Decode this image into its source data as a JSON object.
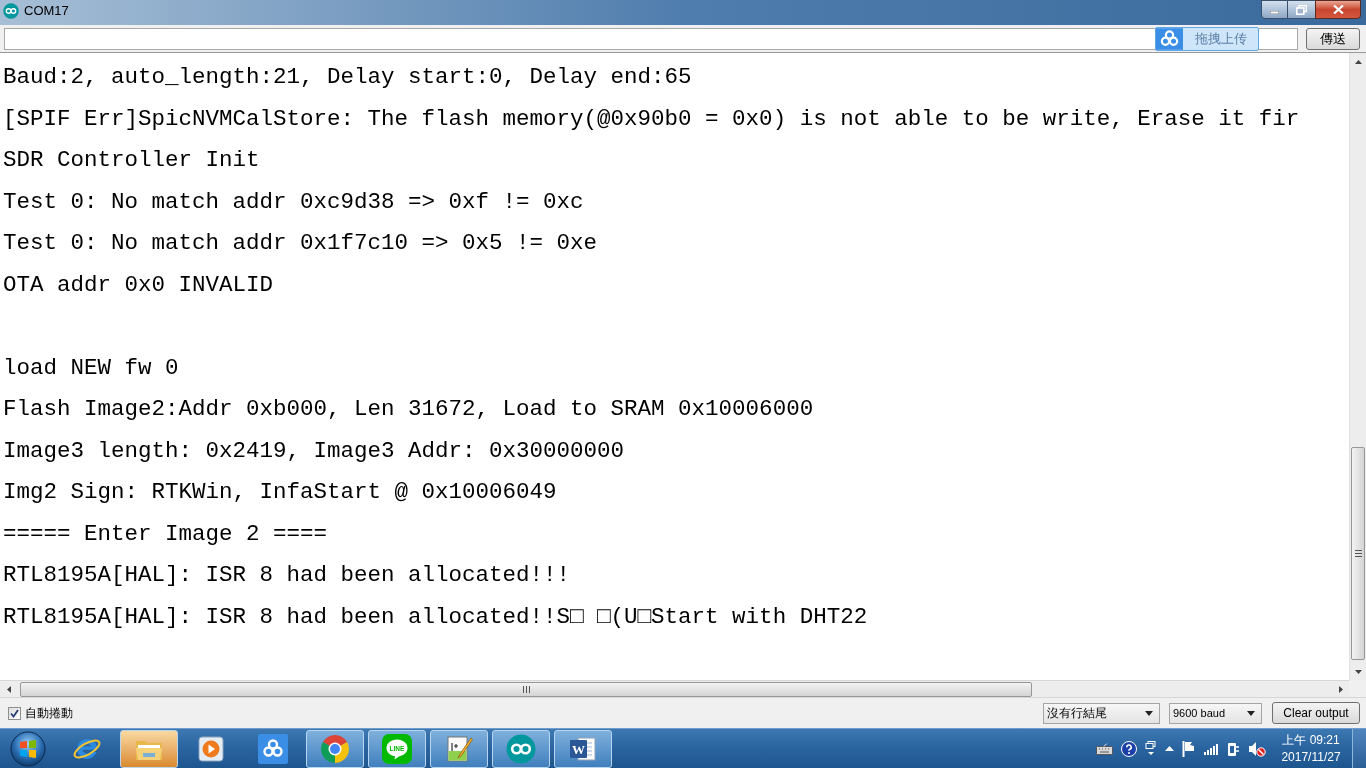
{
  "window": {
    "title": "COM17"
  },
  "send_bar": {
    "send_button": "傳送"
  },
  "upload_overlay": {
    "label": "拖拽上传"
  },
  "output_lines": [
    {
      "kind": "text",
      "text": "Baud:2, auto_length:21, Delay start:0, Delay end:65"
    },
    {
      "kind": "text",
      "text": "[SPIF Err]SpicNVMCalStore: The flash memory(@0x90b0 = 0x0) is not able to be write, Erase it fir"
    },
    {
      "kind": "text",
      "text": "SDR Controller Init"
    },
    {
      "kind": "text",
      "text": "Test 0: No match addr 0xc9d38 => 0xf != 0xc"
    },
    {
      "kind": "text",
      "text": "Test 0: No match addr 0x1f7c10 => 0x5 != 0xe"
    },
    {
      "kind": "text",
      "text": "OTA addr 0x0 INVALID"
    },
    {
      "kind": "blank"
    },
    {
      "kind": "text",
      "text": "load NEW fw 0"
    },
    {
      "kind": "text",
      "text": "Flash Image2:Addr 0xb000, Len 31672, Load to SRAM 0x10006000"
    },
    {
      "kind": "text",
      "text": "Image3 length: 0x2419, Image3 Addr: 0x30000000"
    },
    {
      "kind": "text",
      "text": "Img2 Sign: RTKWin, InfaStart @ 0x10006049"
    },
    {
      "kind": "text",
      "text": "===== Enter Image 2 ===="
    },
    {
      "kind": "text",
      "text": "RTL8195A[HAL]: ISR 8 had been allocated!!!"
    },
    {
      "kind": "text",
      "text": "RTL8195A[HAL]: ISR 8 had been allocated!!S□ □(U□Start with DHT22"
    }
  ],
  "footer": {
    "autoscroll": {
      "label": "自動捲動",
      "checked": true
    },
    "line_ending": {
      "value": "沒有行結尾"
    },
    "baud_rate": {
      "value": "9600 baud"
    },
    "clear_button": "Clear output"
  },
  "taskbar": {
    "apps": [
      {
        "kind": "ie",
        "running": false,
        "highlighted": false
      },
      {
        "kind": "explorer",
        "running": true,
        "highlighted": true
      },
      {
        "kind": "media",
        "running": false,
        "highlighted": false
      },
      {
        "kind": "cloud",
        "running": false,
        "highlighted": false
      },
      {
        "kind": "chrome",
        "running": true,
        "highlighted": false
      },
      {
        "kind": "line",
        "running": true,
        "highlighted": false,
        "logo_text": "LINE"
      },
      {
        "kind": "notepad",
        "running": true,
        "highlighted": false
      },
      {
        "kind": "arduino",
        "running": true,
        "highlighted": false
      },
      {
        "kind": "word",
        "running": true,
        "highlighted": false,
        "logo_text": "W"
      }
    ],
    "clock": {
      "time": "上午 09:21",
      "date": "2017/11/27"
    }
  }
}
